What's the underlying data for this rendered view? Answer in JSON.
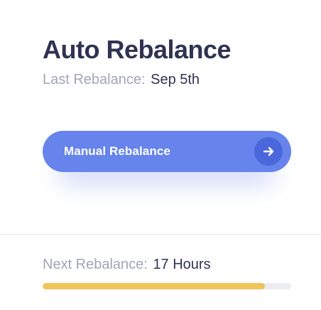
{
  "panel": {
    "title": "Auto Rebalance",
    "last_rebalance_label": "Last Rebalance:",
    "last_rebalance_value": "Sep 5th"
  },
  "manual_button": {
    "label": "Manual Rebalance",
    "icon": "arrow-right-icon",
    "color": "#6684ec",
    "icon_bg_color": "#4a67dc"
  },
  "next_rebalance": {
    "label": "Next Rebalance:",
    "value": "17 Hours",
    "progress_fraction": 0.895,
    "progress_color": "#f0c55a",
    "track_color": "#ebecf0"
  }
}
